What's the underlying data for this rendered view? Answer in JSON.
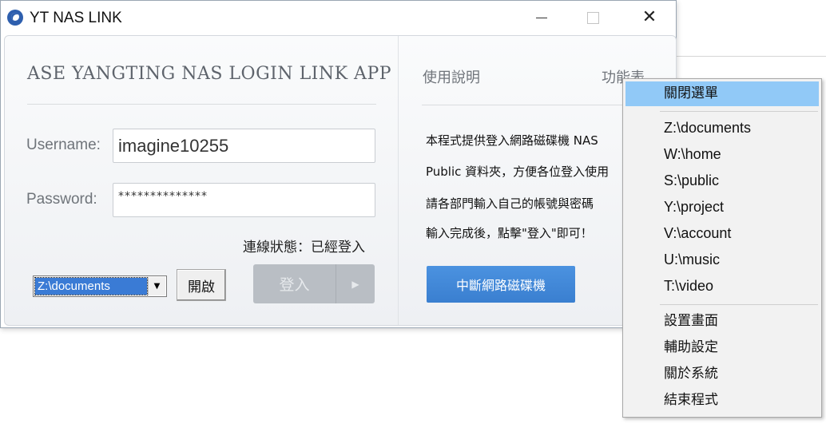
{
  "window": {
    "title": "YT NAS LINK",
    "controls": {
      "minimize": "",
      "maximize": "",
      "close": "✕"
    }
  },
  "login": {
    "heading": "ASE YANGTING NAS LOGIN LINK APP",
    "username_label": "Username:",
    "username_value": "imagine10255",
    "password_label": "Password:",
    "password_value": "**************",
    "status_text": "連線狀態：已經登入",
    "drive_select_value": "Z:\\documents",
    "open_button": "開啟",
    "login_button": "登入",
    "login_arrow": "▶"
  },
  "right_panel": {
    "tabs": [
      "使用說明",
      "功能表"
    ],
    "help_lines": [
      "本程式提供登入網路磁碟機 NAS",
      "Public 資料夾，方便各位登入使用",
      "請各部門輸入自己的帳號與密碼",
      "輸入完成後，點擊\"登入\"即可！"
    ],
    "disconnect_button": "中斷網路磁碟機"
  },
  "context_menu": {
    "close_item": "關閉選單",
    "drives": [
      "Z:\\documents",
      "W:\\home",
      "S:\\public",
      "Y:\\project",
      "V:\\account",
      "U:\\music",
      "T:\\video"
    ],
    "actions": [
      "設置畫面",
      "輔助設定",
      "關於系統",
      "結束程式"
    ]
  },
  "colors": {
    "accent_blue": "#3a7fd0",
    "menu_highlight": "#91c9f7",
    "login_disabled": "#b9bec4"
  }
}
